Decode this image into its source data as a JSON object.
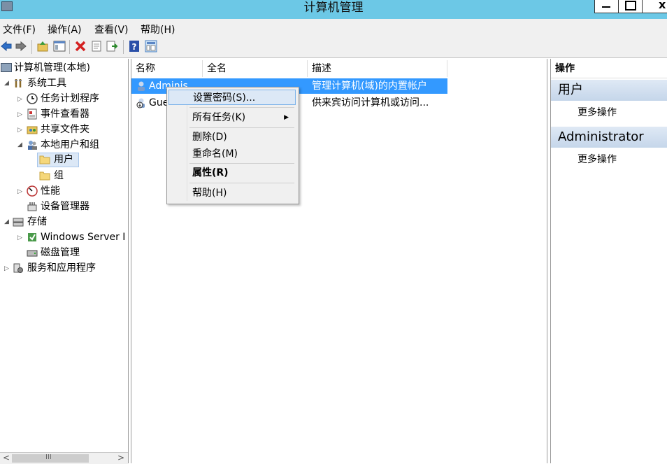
{
  "window": {
    "title": "计算机管理",
    "minimize": "—",
    "maximize": "□",
    "close": "x"
  },
  "menu": [
    "文件(F)",
    "操作(A)",
    "查看(V)",
    "帮助(H)"
  ],
  "tree": [
    {
      "label": "计算机管理(本地)",
      "icon": "computer-management-icon"
    },
    {
      "label": "系统工具",
      "icon": "tools-icon"
    },
    {
      "label": "任务计划程序",
      "icon": "clock-icon"
    },
    {
      "label": "事件查看器",
      "icon": "event-viewer-icon"
    },
    {
      "label": "共享文件夹",
      "icon": "shared-folder-icon"
    },
    {
      "label": "本地用户和组",
      "icon": "users-group-icon"
    },
    {
      "label": "用户",
      "icon": "folder-icon"
    },
    {
      "label": "组",
      "icon": "folder-icon"
    },
    {
      "label": "性能",
      "icon": "performance-icon"
    },
    {
      "label": "设备管理器",
      "icon": "device-manager-icon"
    },
    {
      "label": "存储",
      "icon": "storage-icon"
    },
    {
      "label": "Windows Server I",
      "icon": "windows-backup-icon"
    },
    {
      "label": "磁盘管理",
      "icon": "disk-icon"
    },
    {
      "label": "服务和应用程序",
      "icon": "services-icon"
    }
  ],
  "list": {
    "columns": [
      "名称",
      "全名",
      "描述"
    ],
    "rows": [
      {
        "name": "Adminis",
        "fullname": "",
        "desc": "管理计算机(域)的内置帐户"
      },
      {
        "name": "Gue",
        "fullname": "",
        "desc": "供来宾访问计算机或访问..."
      }
    ]
  },
  "context_menu": {
    "items": [
      "设置密码(S)...",
      "所有任务(K)",
      "删除(D)",
      "重命名(M)",
      "属性(R)",
      "帮助(H)"
    ],
    "submenu_arrow": "▶"
  },
  "actions": {
    "header": "操作",
    "section1": "用户",
    "section1_link": "更多操作",
    "section2": "Administrator",
    "section2_link": "更多操作"
  },
  "scrollbar": {
    "left_arrow": "<",
    "grip": "III",
    "right_arrow": ">"
  }
}
